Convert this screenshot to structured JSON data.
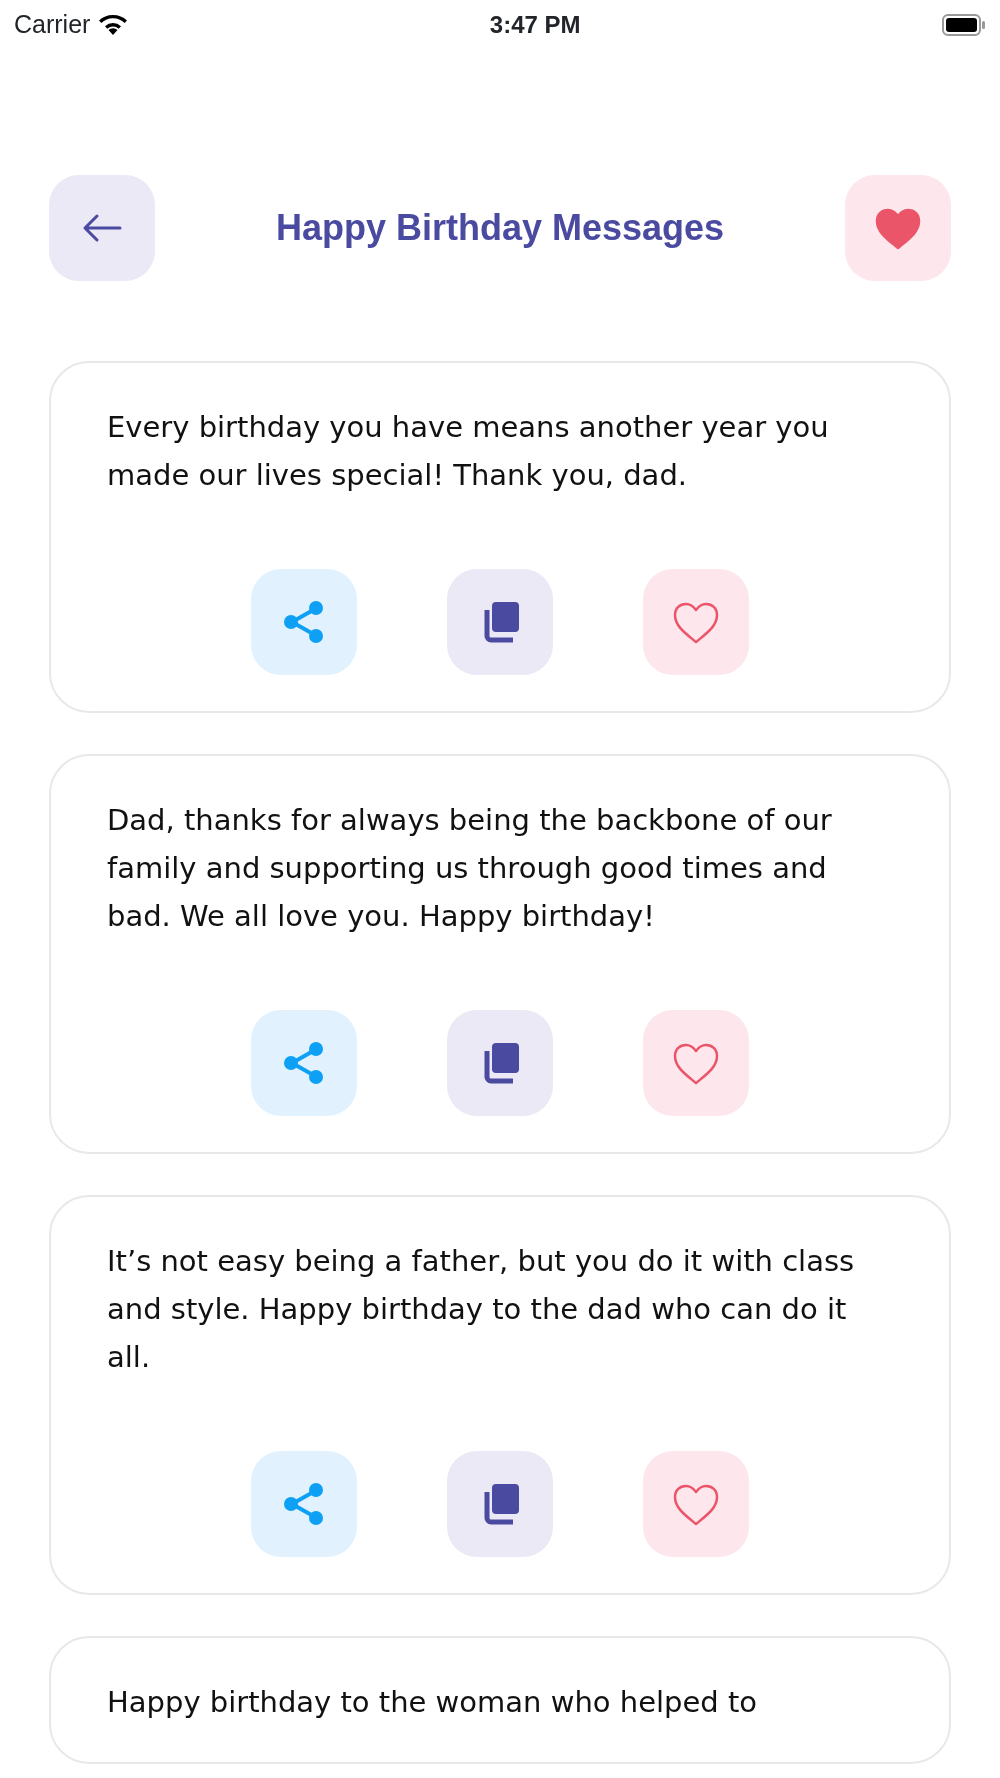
{
  "status_bar": {
    "carrier": "Carrier",
    "time": "3:47 PM"
  },
  "header": {
    "title": "Happy Birthday Messages",
    "favorites_filled": true
  },
  "messages": [
    {
      "text": "Every birthday you have means another year you made our lives special! Thank you, dad.",
      "favorite": false
    },
    {
      "text": "Dad, thanks for always being the backbone of our family and supporting us through good times and bad. We all love you. Happy birthday!",
      "favorite": false
    },
    {
      "text": "It’s not easy being a father, but you do it with class and style. Happy birthday to the dad who can do it all.",
      "favorite": false
    }
  ],
  "partial_message": {
    "text": "Happy birthday to the woman who helped to"
  }
}
